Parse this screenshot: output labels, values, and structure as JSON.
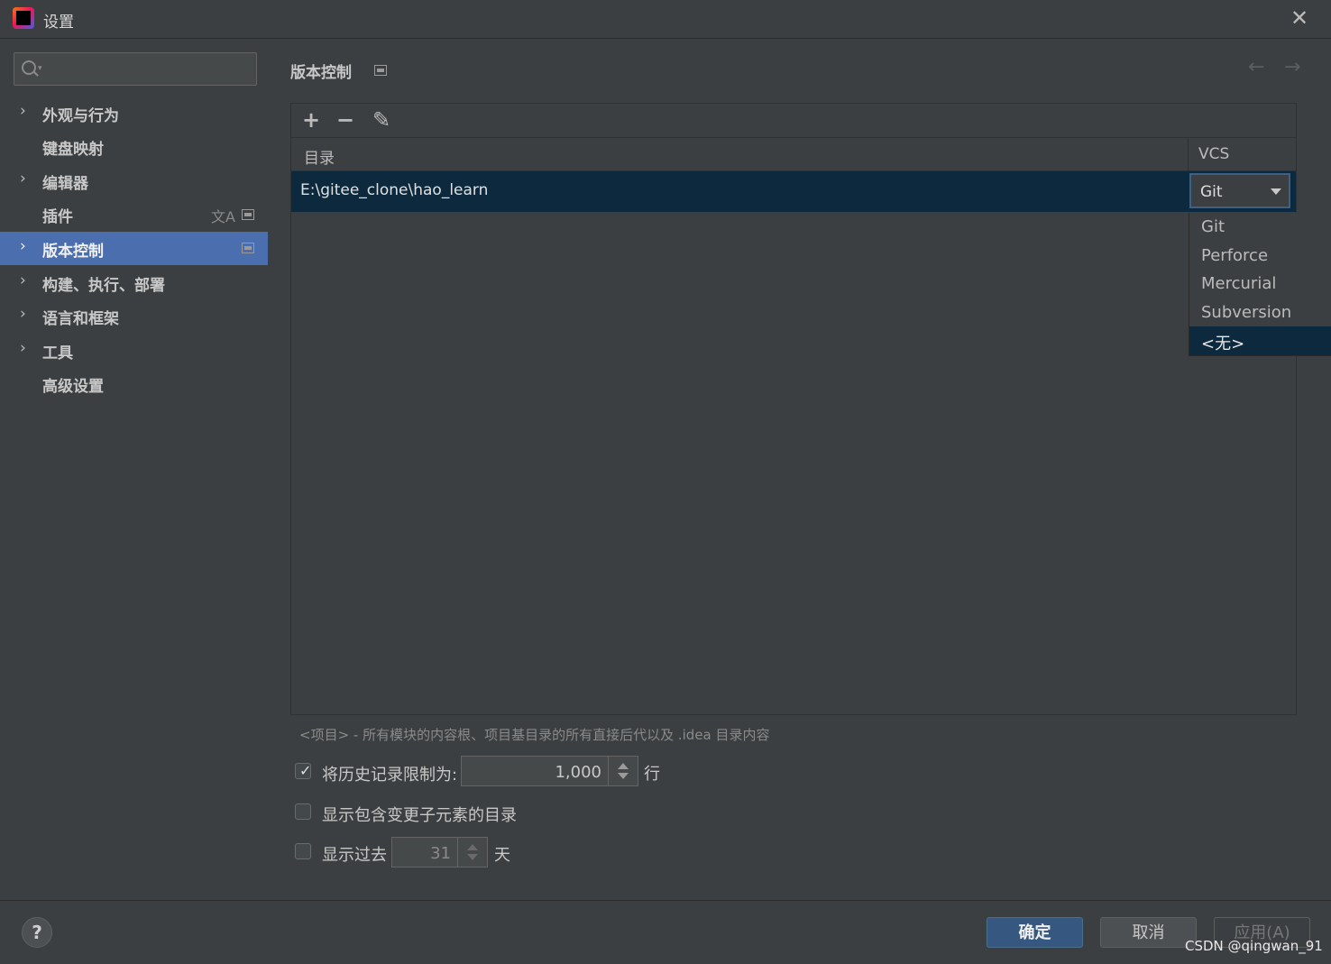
{
  "window": {
    "title": "设置"
  },
  "sidebar": {
    "search_placeholder": "",
    "items": [
      {
        "label": "外观与行为",
        "has_chevron": true
      },
      {
        "label": "键盘映射",
        "has_chevron": false
      },
      {
        "label": "编辑器",
        "has_chevron": true
      },
      {
        "label": "插件",
        "has_chevron": false
      },
      {
        "label": "版本控制",
        "has_chevron": true,
        "selected": true
      },
      {
        "label": "构建、执行、部署",
        "has_chevron": true
      },
      {
        "label": "语言和框架",
        "has_chevron": true
      },
      {
        "label": "工具",
        "has_chevron": true
      },
      {
        "label": "高级设置",
        "has_chevron": false
      }
    ],
    "chevron": "›"
  },
  "main": {
    "title": "版本控制",
    "toolbar": {
      "add": "+",
      "remove": "−",
      "edit": "✎"
    },
    "table": {
      "columns": [
        "目录",
        "VCS"
      ],
      "rows": [
        {
          "directory": "E:\\gitee_clone\\hao_learn",
          "vcs": "Git"
        }
      ]
    },
    "vcs_options": [
      "Git",
      "Perforce",
      "Mercurial",
      "Subversion",
      "<无>"
    ],
    "vcs_options_selected_index": 4,
    "hint": "<项目> - 所有模块的内容根、项目基目录的所有直接后代以及 .idea 目录内容",
    "history_limit": {
      "label": "将历史记录限制为:",
      "checked": true,
      "value": "1,000",
      "unit": "行"
    },
    "show_dirs": {
      "label": "显示包含变更子元素的目录",
      "checked": false
    },
    "show_past": {
      "label": "显示过去",
      "checked": false,
      "value": "31",
      "unit": "天"
    }
  },
  "footer": {
    "help": "?",
    "ok": "确定",
    "cancel": "取消",
    "apply": "应用(A)"
  },
  "watermark": "CSDN @qingwan_91",
  "colors": {
    "selection": "#4b6eaf",
    "row_selected": "#0d293e",
    "ok_button": "#365880",
    "background": "#3c3f41"
  }
}
